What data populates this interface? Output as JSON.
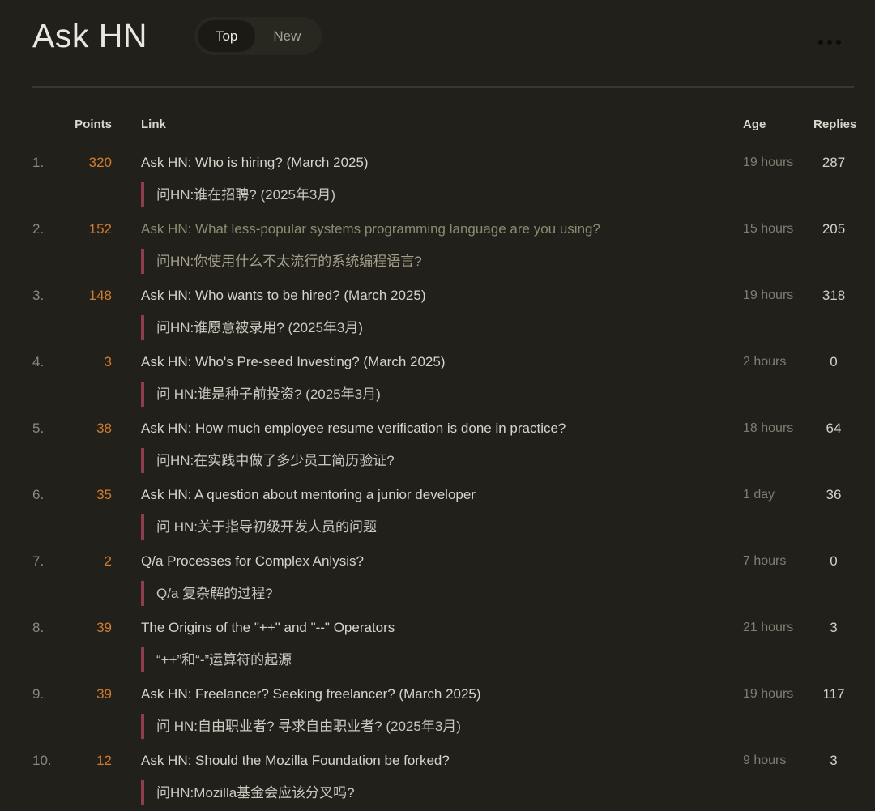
{
  "header": {
    "title": "Ask HN",
    "tabs": [
      {
        "label": "Top",
        "active": true
      },
      {
        "label": "New",
        "active": false
      }
    ],
    "menu_icon": "ellipsis"
  },
  "table": {
    "columns": {
      "points": "Points",
      "link": "Link",
      "age": "Age",
      "replies": "Replies"
    },
    "rows": [
      {
        "rank": "1.",
        "points": "320",
        "title": "Ask HN: Who is hiring? (March 2025)",
        "translation": "问HN:谁在招聘? (2025年3月)",
        "age": "19 hours",
        "replies": "287",
        "visited": false
      },
      {
        "rank": "2.",
        "points": "152",
        "title": "Ask HN: What less-popular systems programming language are you using?",
        "translation": "问HN:你使用什么不太流行的系统编程语言?",
        "age": "15 hours",
        "replies": "205",
        "visited": true
      },
      {
        "rank": "3.",
        "points": "148",
        "title": "Ask HN: Who wants to be hired? (March 2025)",
        "translation": "问HN:谁愿意被录用? (2025年3月)",
        "age": "19 hours",
        "replies": "318",
        "visited": false
      },
      {
        "rank": "4.",
        "points": "3",
        "title": "Ask HN: Who's Pre-seed Investing? (March 2025)",
        "translation": "问 HN:谁是种子前投资? (2025年3月)",
        "age": "2 hours",
        "replies": "0",
        "visited": false
      },
      {
        "rank": "5.",
        "points": "38",
        "title": "Ask HN: How much employee resume verification is done in practice?",
        "translation": "问HN:在实践中做了多少员工简历验证?",
        "age": "18 hours",
        "replies": "64",
        "visited": false
      },
      {
        "rank": "6.",
        "points": "35",
        "title": "Ask HN: A question about mentoring a junior developer",
        "translation": "问 HN:关于指导初级开发人员的问题",
        "age": "1 day",
        "replies": "36",
        "visited": false
      },
      {
        "rank": "7.",
        "points": "2",
        "title": "Q/a Processes for Complex Anlysis?",
        "translation": "Q/a 复杂解的过程?",
        "age": "7 hours",
        "replies": "0",
        "visited": false
      },
      {
        "rank": "8.",
        "points": "39",
        "title": "The Origins of the \"++\" and \"--\" Operators",
        "translation": "“++”和“-”运算符的起源",
        "age": "21 hours",
        "replies": "3",
        "visited": false
      },
      {
        "rank": "9.",
        "points": "39",
        "title": "Ask HN: Freelancer? Seeking freelancer? (March 2025)",
        "translation": "问 HN:自由职业者? 寻求自由职业者? (2025年3月)",
        "age": "19 hours",
        "replies": "117",
        "visited": false
      },
      {
        "rank": "10.",
        "points": "12",
        "title": "Ask HN: Should the Mozilla Foundation be forked?",
        "translation": "问HN:Mozilla基金会应该分叉吗?",
        "age": "9 hours",
        "replies": "3",
        "visited": false
      }
    ]
  },
  "colors": {
    "background": "#21201a",
    "accent_orange": "#d07b31",
    "quote_bar_maroon": "#8e3e4d",
    "text_primary": "#d7d4c9",
    "text_muted": "#8b887c",
    "visited_title": "#8e8a72",
    "divider": "#39382f"
  }
}
